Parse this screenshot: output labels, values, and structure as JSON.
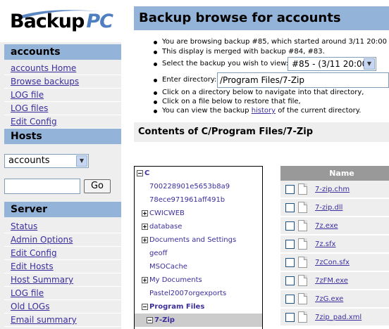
{
  "logo": {
    "backup": "Backup",
    "pc": "PC"
  },
  "sidebar": {
    "accounts_title": "accounts",
    "accounts_links": [
      "accounts Home",
      "Browse backups",
      "LOG file",
      "LOG files",
      "Edit Config"
    ],
    "hosts_title": "Hosts",
    "host_select_value": "accounts",
    "go_label": "Go",
    "server_title": "Server",
    "server_links": [
      "Status",
      "Admin Options",
      "Edit Config",
      "Edit Hosts",
      "Host Summary",
      "LOG file",
      "Old LOGs",
      "Email summary"
    ]
  },
  "main": {
    "title": "Backup browse for accounts",
    "info_line1": "You are browsing backup #85, which started around 3/11 20:00 (1",
    "info_line2": "This display is merged with backup #84, #83.",
    "select_label": "Select the backup you wish to view:",
    "backup_select_value": "#85 - (3/11 20:00)",
    "dir_label": "Enter directory:",
    "dir_value": "/Program Files/7-Zip",
    "hint1": "Click on a directory below to navigate into that directory,",
    "hint2": "Click on a file below to restore that file,",
    "hint3_pre": "You can view the backup",
    "hint3_link": "history",
    "hint3_post": "of the current directory.",
    "contents_title": "Contents of C/Program Files/7-Zip"
  },
  "tree": [
    {
      "label": "C",
      "expander": "minus",
      "bold": true,
      "level": 0
    },
    {
      "label": "700228901e5653b8a9",
      "expander": "none",
      "bold": false,
      "level": 1
    },
    {
      "label": "78ece971961aff491b",
      "expander": "none",
      "bold": false,
      "level": 1
    },
    {
      "label": "CWICWEB",
      "expander": "plus",
      "bold": false,
      "level": 1
    },
    {
      "label": "database",
      "expander": "plus",
      "bold": false,
      "level": 1
    },
    {
      "label": "Documents and Settings",
      "expander": "plus",
      "bold": false,
      "level": 1
    },
    {
      "label": "geoff",
      "expander": "none",
      "bold": false,
      "level": 1
    },
    {
      "label": "MSOCache",
      "expander": "none",
      "bold": false,
      "level": 1
    },
    {
      "label": "My Documents",
      "expander": "plus",
      "bold": false,
      "level": 1
    },
    {
      "label": "Pastel2007orgexports",
      "expander": "none",
      "bold": false,
      "level": 1
    },
    {
      "label": "Program Files",
      "expander": "minus",
      "bold": true,
      "level": 1
    },
    {
      "label": "7-Zip",
      "expander": "minus",
      "bold": true,
      "level": 2,
      "selected": true
    }
  ],
  "files": {
    "header": "Name",
    "items": [
      "7-zip.chm",
      "7-zip.dll",
      "7z.exe",
      "7z.sfx",
      "7zCon.sfx",
      "7zFM.exe",
      "7zG.exe",
      "7zip_pad.xml"
    ]
  }
}
